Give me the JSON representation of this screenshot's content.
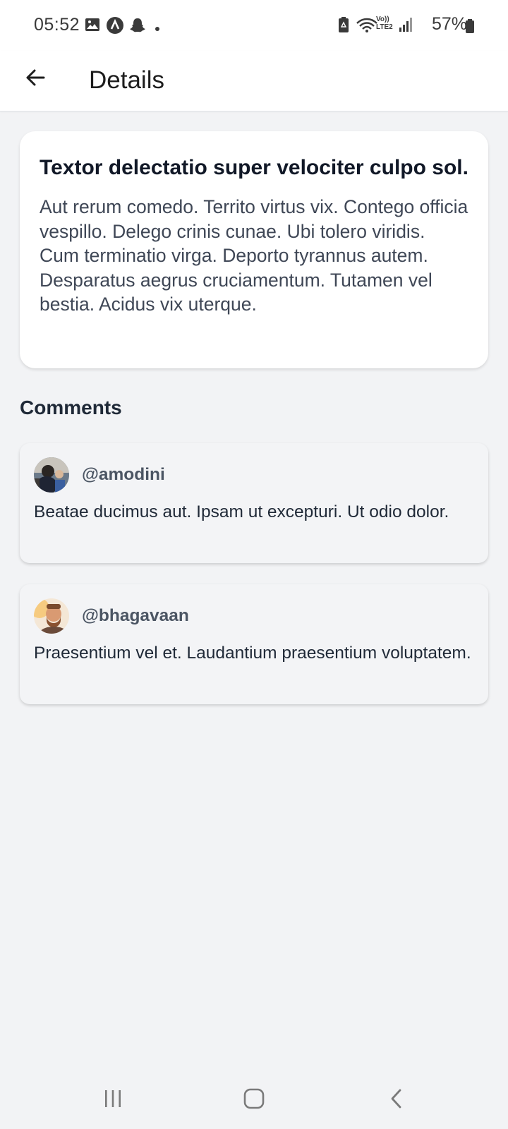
{
  "status_bar": {
    "time": "05:52",
    "battery_text": "57%",
    "network_label": "LTE2",
    "volte_label": "Vo))"
  },
  "app_bar": {
    "title": "Details",
    "back_icon": "arrow-left-icon"
  },
  "post": {
    "title": "Textor delectatio super velociter culpo sol.",
    "body": "Aut rerum comedo. Territo virtus vix. Contego officia vespillo. Delego crinis cunae. Ubi tolero viridis. Cum terminatio virga. Deporto tyrannus autem. Desparatus aegrus cruciamentum. Tutamen vel bestia. Acidus vix uterque."
  },
  "comments": {
    "heading": "Comments",
    "items": [
      {
        "username": "@amodini",
        "text": "Beatae ducimus aut. Ipsam ut excepturi. Ut odio dolor."
      },
      {
        "username": "@bhagavaan",
        "text": "Praesentium vel et. Laudantium praesentium voluptatem."
      }
    ]
  },
  "nav_bar": {
    "recents_icon": "recents-icon",
    "home_icon": "home-icon",
    "back_icon": "chevron-left-icon"
  },
  "colors": {
    "background": "#f2f3f5",
    "card": "#ffffff",
    "comment_card": "#f3f4f6",
    "title_text": "#111827",
    "body_text": "#3f4756"
  }
}
